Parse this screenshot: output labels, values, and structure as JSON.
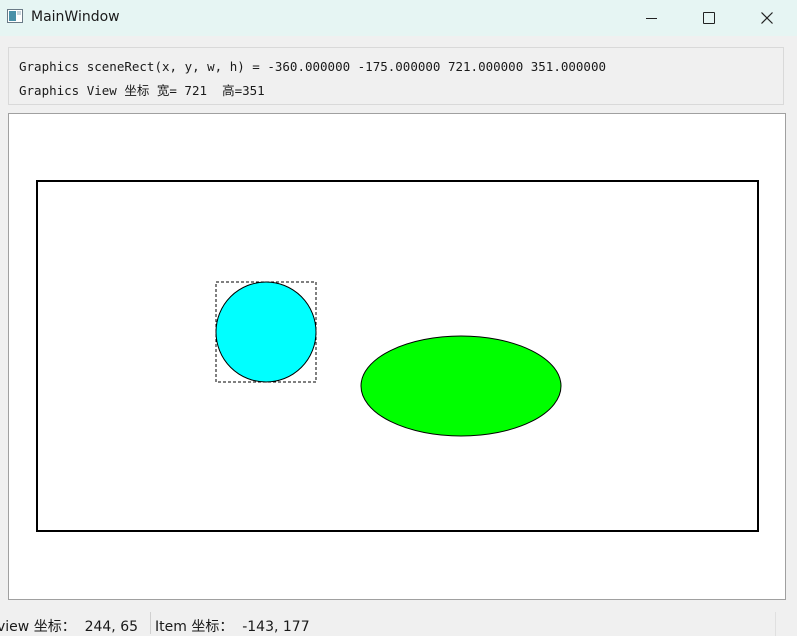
{
  "window": {
    "title": "MainWindow",
    "icon": "app-window-icon",
    "controls": {
      "minimize_icon": "minimize-icon",
      "maximize_icon": "maximize-icon",
      "close_icon": "close-icon"
    }
  },
  "info": {
    "line1": "Graphics sceneRect(x, y, w, h) = -360.000000 -175.000000 721.000000 351.000000",
    "line2": "Graphics View 坐标 宽= 721  高=351"
  },
  "scene": {
    "colors": {
      "border": "#000000",
      "circle_fill": "#00ffff",
      "ellipse_fill": "#00ff00",
      "selection": "#000000"
    },
    "items": [
      {
        "name": "scene-border-rect",
        "shape": "rectangle"
      },
      {
        "name": "cyan-circle",
        "shape": "circle",
        "selected": true
      },
      {
        "name": "green-ellipse",
        "shape": "ellipse",
        "selected": false
      }
    ]
  },
  "statusbar": {
    "view_coords": "view 坐标：  244, 65",
    "item_coords": "Item 坐标：  -143, 177"
  }
}
